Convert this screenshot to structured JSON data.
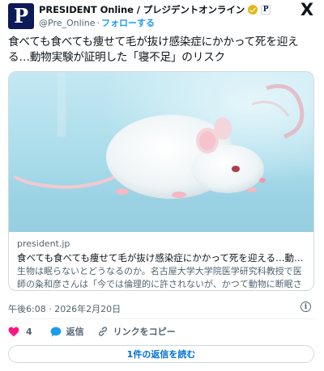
{
  "account": {
    "display_name": "PRESIDENT Online / プレジデントオンライン",
    "avatar_letter": "P",
    "affiliate_letter": "P",
    "handle": "@Pre_Online",
    "separator": "·",
    "follow_label": "フォローする",
    "verified_color": "#e2b719",
    "avatar_color": "#0c1a57"
  },
  "platform_logo": "X",
  "tweet": {
    "text": "食べても食べても痩せて毛が抜け感染症にかかって死を迎える…動物実験が証明した「寝不足」のリスク"
  },
  "card": {
    "image": "white-mouse-photo",
    "domain": "president.jp",
    "title": "食べても食べても痩せて毛が抜け感染症にかかって死を迎える…動物実験が証明した「寝不足」のリスク",
    "description": "生物は眠らないとどうなるのか。名古屋大学大学院医学研究科教授で医師の粂和彦さんは「今では倫理的に許されないが、かつて動物に断眠させる実験が行われた"
  },
  "meta": {
    "timestamp": "午後6:08 · 2026年2月20日",
    "info_icon": "i"
  },
  "actions": {
    "like_count": "4",
    "reply_label": "返信",
    "copy_link_label": "リンクをコピー",
    "like_color": "#f91880",
    "accent_color": "#1d9bf0"
  },
  "read_replies_label": "1件の返信を読む"
}
